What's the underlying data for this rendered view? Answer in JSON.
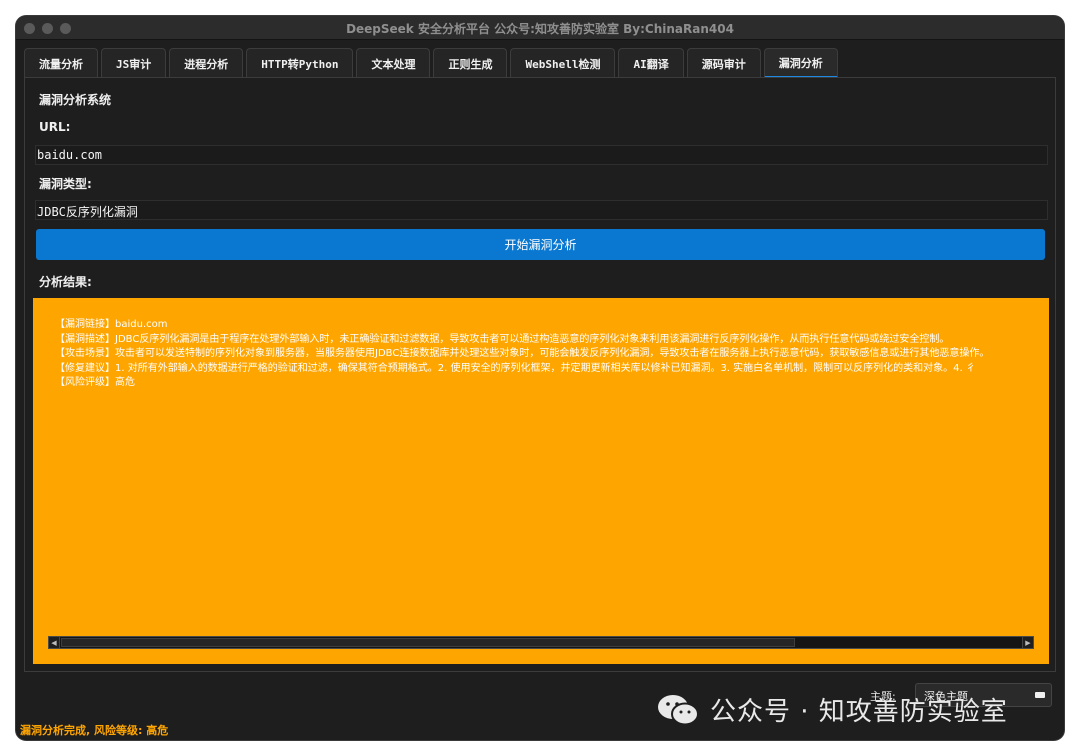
{
  "window": {
    "title": "DeepSeek 安全分析平台 公众号:知攻善防实验室 By:ChinaRan404"
  },
  "tabs": [
    {
      "label": "流量分析",
      "active": false
    },
    {
      "label": "JS审计",
      "active": false
    },
    {
      "label": "进程分析",
      "active": false
    },
    {
      "label": "HTTP转Python",
      "active": false
    },
    {
      "label": "文本处理",
      "active": false
    },
    {
      "label": "正则生成",
      "active": false
    },
    {
      "label": "WebShell检测",
      "active": false
    },
    {
      "label": "AI翻译",
      "active": false
    },
    {
      "label": "源码审计",
      "active": false
    },
    {
      "label": "漏洞分析",
      "active": true
    }
  ],
  "panel": {
    "heading": "漏洞分析系统",
    "url_label": "URL:",
    "url_value": "baidu.com",
    "vuln_type_label": "漏洞类型:",
    "vuln_type_value": "JDBC反序列化漏洞",
    "analyze_button": "开始漏洞分析",
    "result_label": "分析结果:",
    "result_lines": [
      "【漏洞链接】baidu.com",
      "【漏洞描述】JDBC反序列化漏洞是由于程序在处理外部输入时，未正确验证和过滤数据，导致攻击者可以通过构造恶意的序列化对象来利用该漏洞进行反序列化操作，从而执行任意代码或绕过安全控制。",
      "【攻击场景】攻击者可以发送特制的序列化对象到服务器，当服务器使用JDBC连接数据库并处理这些对象时，可能会触发反序列化漏洞，导致攻击者在服务器上执行恶意代码，获取敏感信息或进行其他恶意操作。",
      "【修复建议】1. 对所有外部输入的数据进行严格的验证和过滤，确保其符合预期格式。2. 使用安全的序列化框架，并定期更新相关库以修补已知漏洞。3. 实施白名单机制，限制可以反序列化的类和对象。4. 彳",
      "【风险评级】高危"
    ]
  },
  "footer": {
    "theme_label": "主题:",
    "theme_value": "深色主题",
    "watermark": "公众号 · 知攻善防实验室",
    "status": "漏洞分析完成, 风险等级: 高危"
  },
  "colors": {
    "accent": "#0a78d0",
    "result_bg": "#ffa500",
    "window_bg": "#1e1e1e",
    "status_text": "#ffa500"
  },
  "icons": {
    "scroll_left": "chevron-left-icon",
    "scroll_right": "chevron-right-icon",
    "watermark": "wechat-icon"
  }
}
